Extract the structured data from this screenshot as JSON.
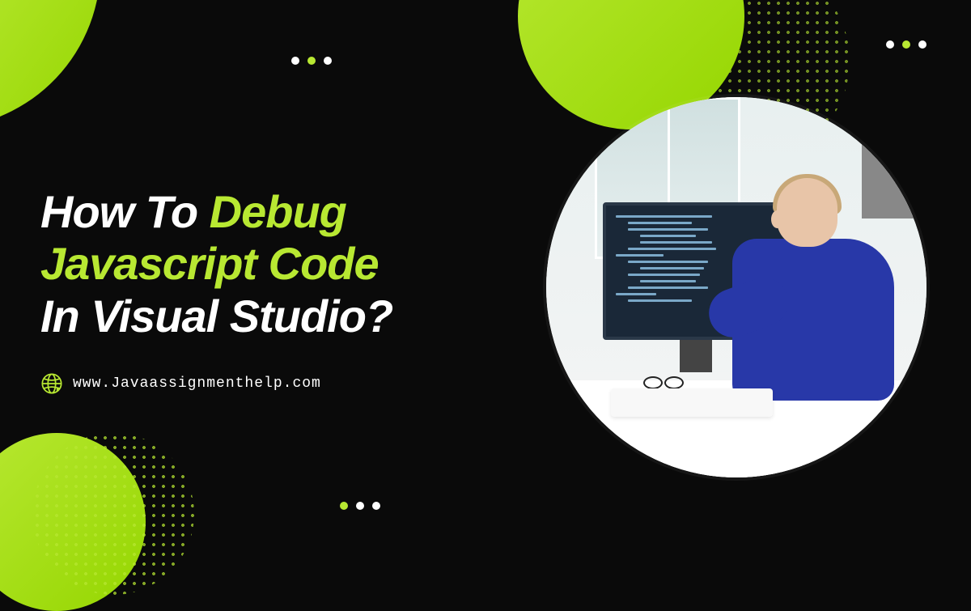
{
  "heading": {
    "part1": "How To ",
    "part2": "Debug",
    "line2": "Javascript Code",
    "line3": "In Visual Studio?"
  },
  "website": {
    "url": "www.Javaassignmenthelp.com"
  },
  "colors": {
    "accent": "#b8e832",
    "background": "#0a0a0a",
    "text_primary": "#ffffff"
  },
  "decorations": {
    "dots_pattern": "halftone",
    "shapes": [
      "circle",
      "quarter-circle"
    ]
  }
}
